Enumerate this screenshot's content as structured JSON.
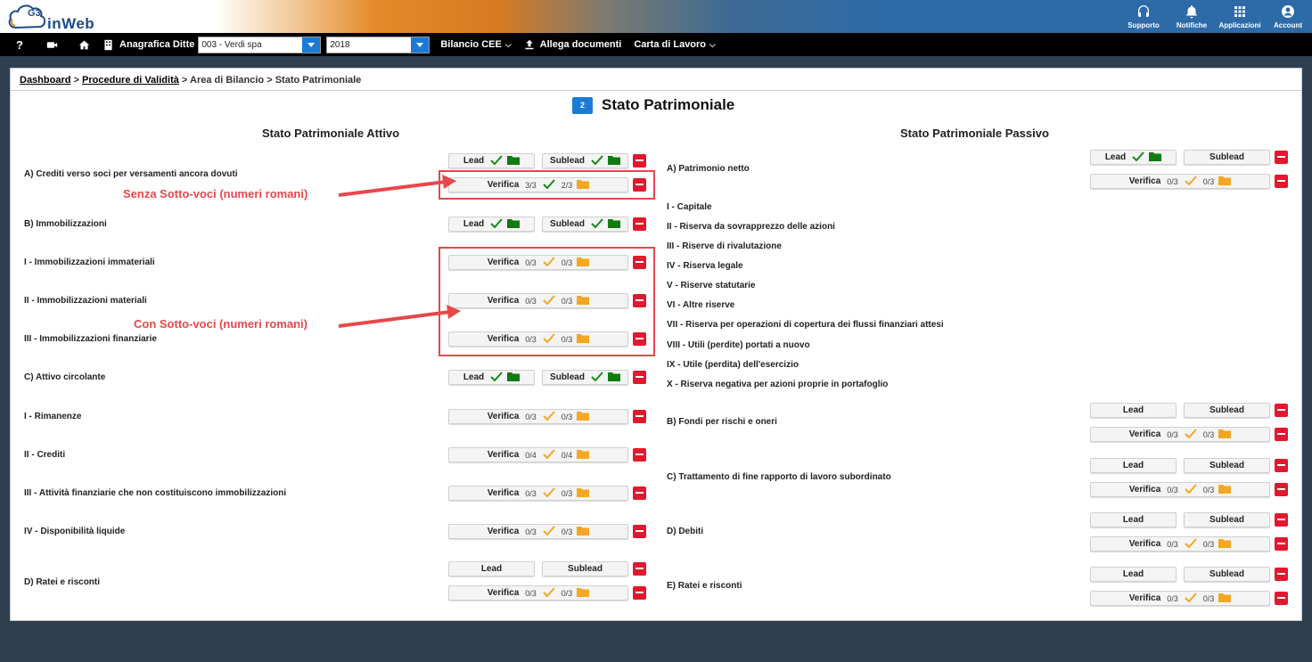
{
  "app": {
    "logo_text": "inWeb",
    "logo_num": "G3"
  },
  "top_icons": [
    {
      "label": "Supporto",
      "icon": "headset-icon"
    },
    {
      "label": "Notifiche",
      "icon": "bell-icon"
    },
    {
      "label": "Applicazioni",
      "icon": "apps-grid-icon"
    },
    {
      "label": "Account",
      "icon": "account-icon"
    }
  ],
  "navbar": {
    "help": "?",
    "anagrafica_label": "Anagrafica Ditte",
    "company_select": "003 - Verdi spa",
    "year_select": "2018",
    "bilancio": "Bilancio CEE",
    "allega": "Allega documenti",
    "carta": "Carta di Lavoro"
  },
  "breadcrumb": {
    "dashboard": "Dashboard",
    "procedure": "Procedure di Validità",
    "area": "Area di Bilancio",
    "current": "Stato Patrimoniale",
    "sep": ">"
  },
  "page": {
    "badge": "2",
    "title": "Stato Patrimoniale",
    "col_left": "Stato Patrimoniale Attivo",
    "col_right": "Stato Patrimoniale Passivo"
  },
  "buttons": {
    "lead": "Lead",
    "sublead": "Sublead",
    "verifica": "Verifica"
  },
  "colors": {
    "check_done": "#178a17",
    "check_pending": "#f5a623",
    "folder_done": "#0f7d0f",
    "folder_pending": "#f5a623",
    "minus": "#e3182d",
    "accent": "#1a7bd6",
    "callout": "#e8474a"
  },
  "annotations": {
    "senza": "Senza Sotto-voci (numeri romani)",
    "con": "Con Sotto-voci (numeri romani)"
  },
  "attivo": [
    {
      "label": "A) Crediti verso soci per versamenti ancora dovuti",
      "lead": true,
      "lead_done": true,
      "verifica": true,
      "v1": "3/3",
      "v2": "2/3",
      "v1_done": true
    },
    {
      "label": "B) Immobilizzazioni",
      "lead": true,
      "lead_done": true,
      "verifica": false
    },
    {
      "label": "I - Immobilizzazioni immateriali",
      "lead": false,
      "verifica": true,
      "v1": "0/3",
      "v2": "0/3"
    },
    {
      "label": "II - Immobilizzazioni materiali",
      "lead": false,
      "verifica": true,
      "v1": "0/3",
      "v2": "0/3"
    },
    {
      "label": "III - Immobilizzazioni finanziarie",
      "lead": false,
      "verifica": true,
      "v1": "0/3",
      "v2": "0/3"
    },
    {
      "label": "C) Attivo circolante",
      "lead": true,
      "lead_done": true,
      "verifica": false
    },
    {
      "label": "I - Rimanenze",
      "lead": false,
      "verifica": true,
      "v1": "0/3",
      "v2": "0/3"
    },
    {
      "label": "II - Crediti",
      "lead": false,
      "verifica": true,
      "v1": "0/4",
      "v2": "0/4"
    },
    {
      "label": "III - Attività finanziarie che non costituiscono immobilizzazioni",
      "lead": false,
      "verifica": true,
      "v1": "0/3",
      "v2": "0/3"
    },
    {
      "label": "IV - Disponibilità liquide",
      "lead": false,
      "verifica": true,
      "v1": "0/3",
      "v2": "0/3"
    },
    {
      "label": "D) Ratei e risconti",
      "lead": true,
      "lead_done": false,
      "verifica": true,
      "v1": "0/3",
      "v2": "0/3"
    }
  ],
  "passivo": [
    {
      "label": "A) Patrimonio netto",
      "lead": true,
      "lead_done": true,
      "sub_done": false,
      "verifica": true,
      "v1": "0/3",
      "v2": "0/3"
    },
    {
      "label": "I - Capitale"
    },
    {
      "label": "II - Riserva da sovrapprezzo delle azioni"
    },
    {
      "label": "III - Riserve di rivalutazione"
    },
    {
      "label": "IV - Riserva legale"
    },
    {
      "label": "V - Riserve statutarie"
    },
    {
      "label": "VI - Altre riserve"
    },
    {
      "label": "VII - Riserva per operazioni di copertura dei flussi finanziari attesi"
    },
    {
      "label": "VIII - Utili (perdite) portati a nuovo"
    },
    {
      "label": "IX - Utile (perdita) dell'esercizio"
    },
    {
      "label": "X - Riserva negativa per azioni proprie in portafoglio"
    },
    {
      "label": "B) Fondi per rischi e oneri",
      "lead": true,
      "lead_done": false,
      "verifica": true,
      "v1": "0/3",
      "v2": "0/3"
    },
    {
      "label": "C) Trattamento di fine rapporto di lavoro subordinato",
      "lead": true,
      "lead_done": false,
      "verifica": true,
      "v1": "0/3",
      "v2": "0/3"
    },
    {
      "label": "D) Debiti",
      "lead": true,
      "lead_done": false,
      "verifica": true,
      "v1": "0/3",
      "v2": "0/3"
    },
    {
      "label": "E) Ratei e risconti",
      "lead": true,
      "lead_done": false,
      "verifica": true,
      "v1": "0/3",
      "v2": "0/3"
    }
  ]
}
